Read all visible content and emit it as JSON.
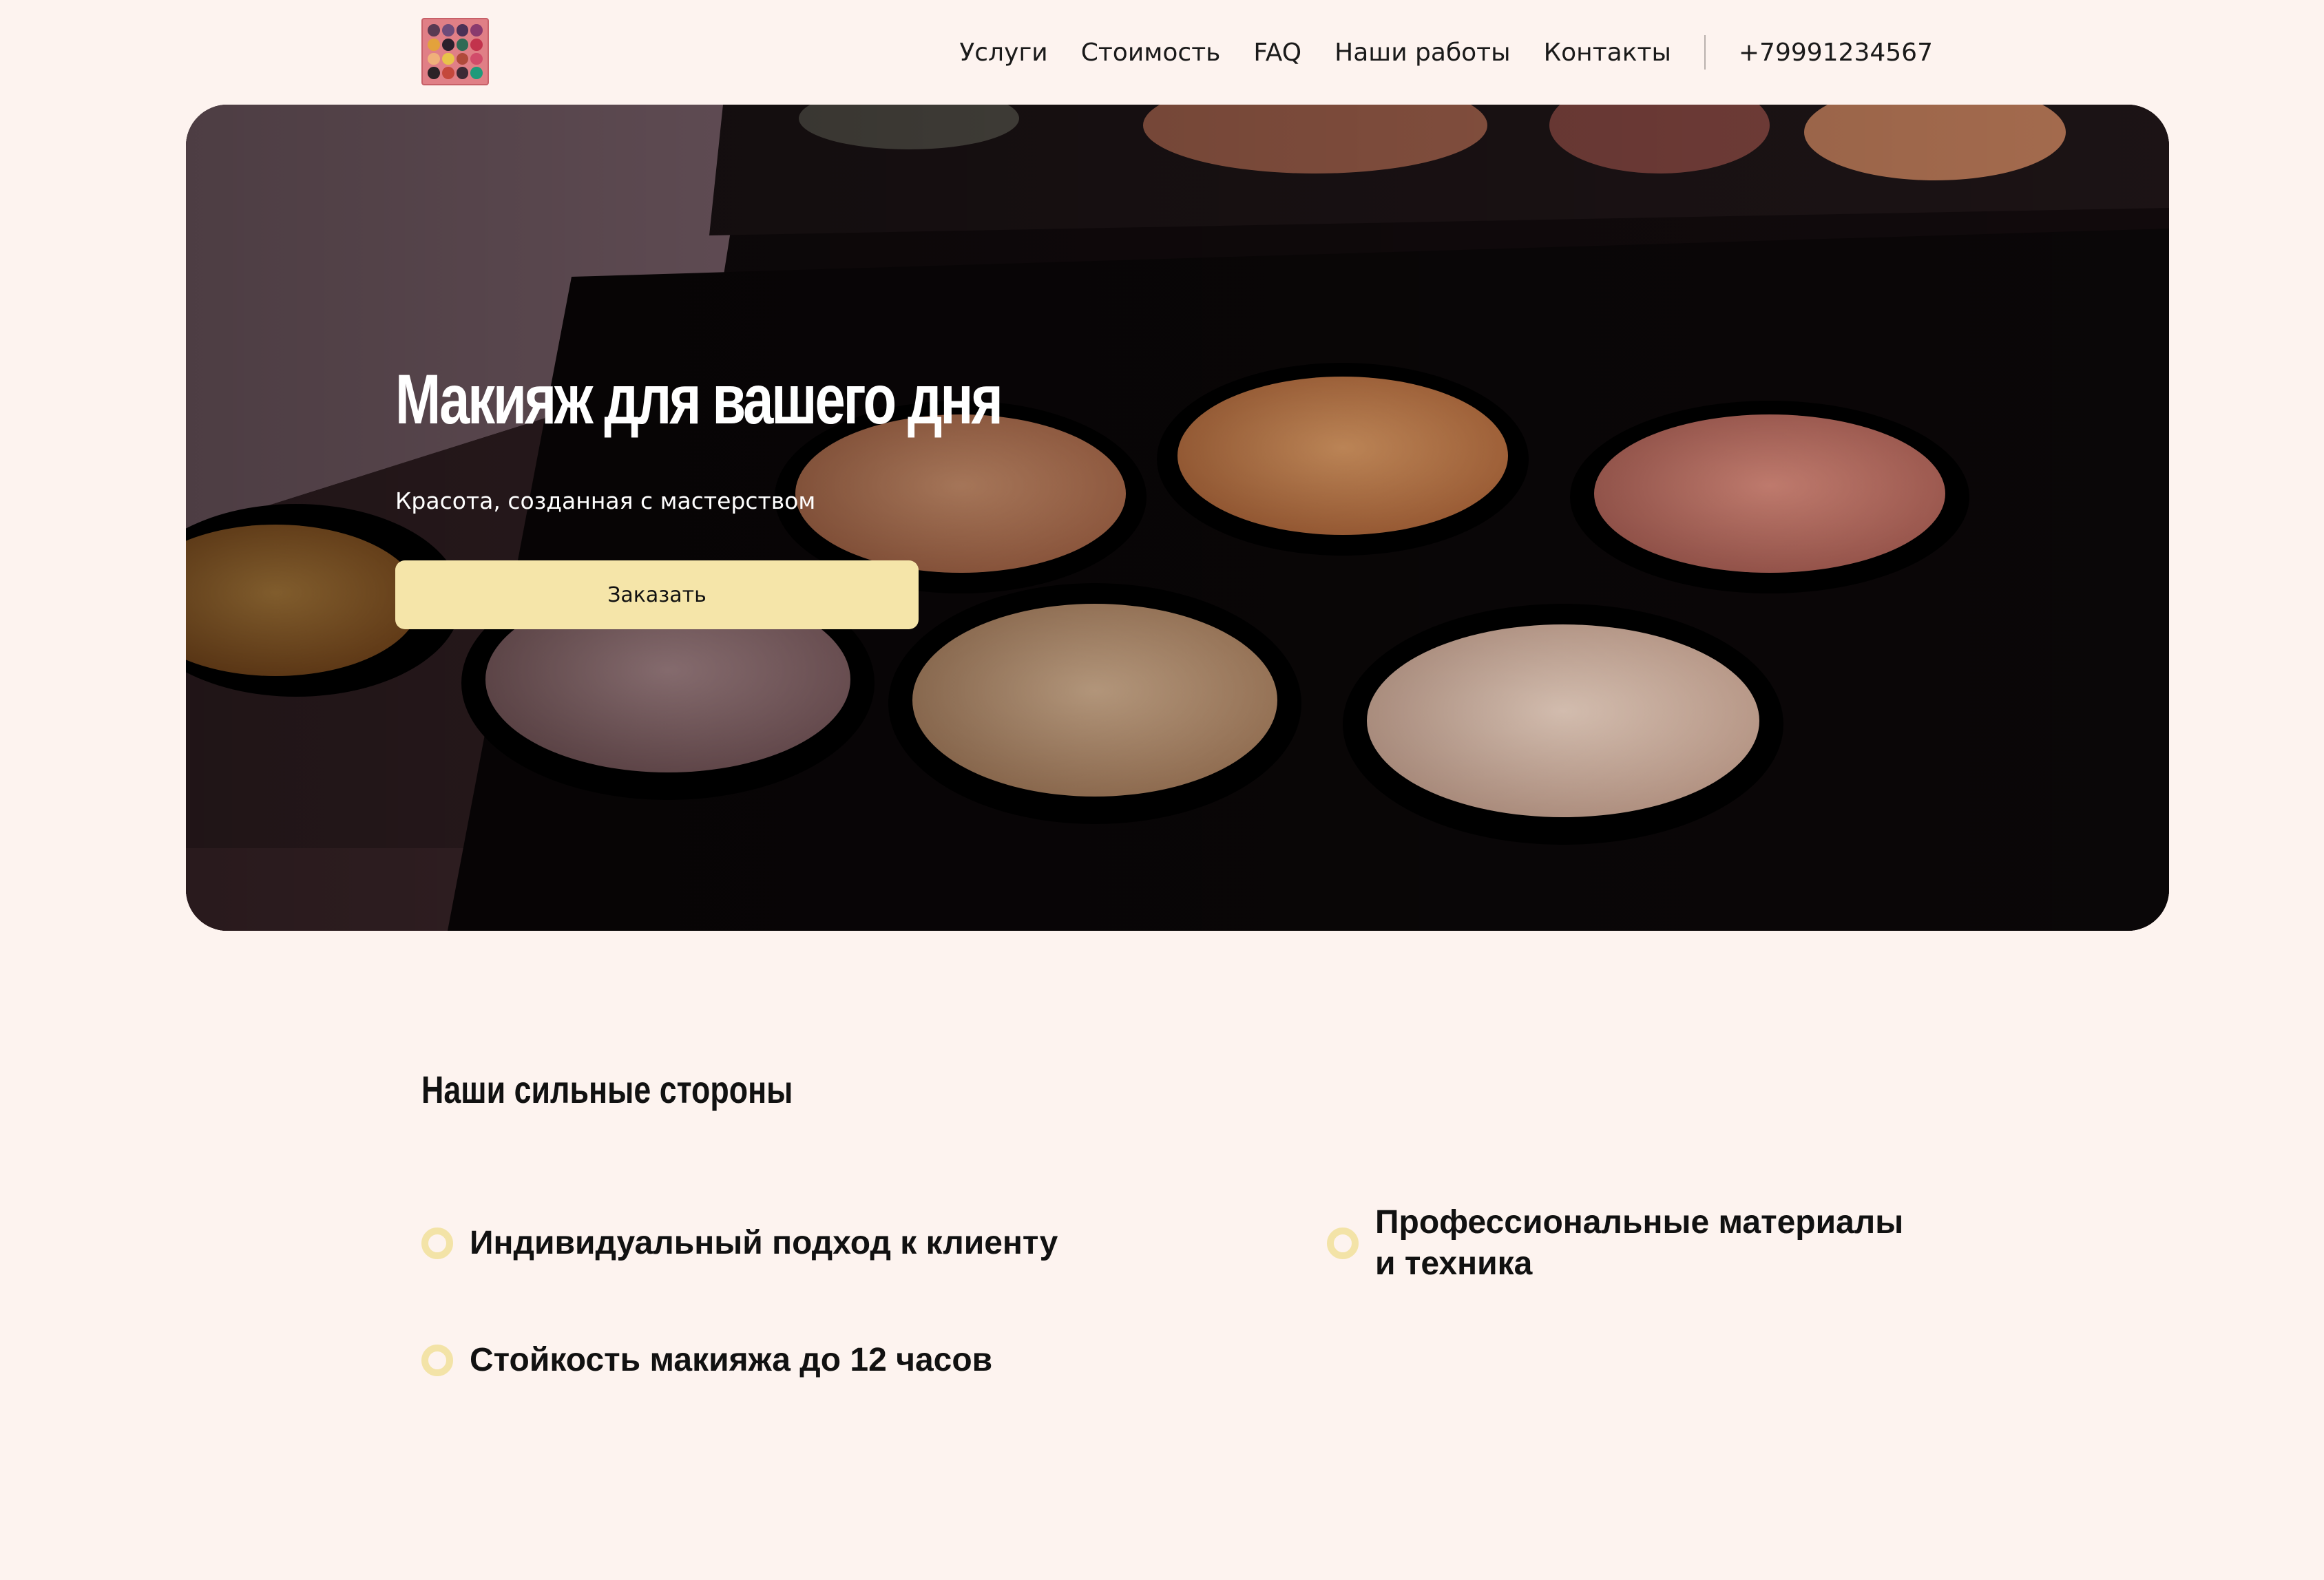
{
  "header": {
    "logo": "palette-logo",
    "nav": [
      "Услуги",
      "Стоимость",
      "FAQ",
      "Наши работы",
      "Контакты"
    ],
    "phone": "+79991234567"
  },
  "hero": {
    "title": "Макияж для вашего дня",
    "subtitle": "Красота, созданная с мастерством",
    "cta_label": "Заказать",
    "image": "makeup-palette-photo"
  },
  "strengths": {
    "title": "Наши сильные стороны",
    "items": [
      "Индивидуальный подход к клиенту",
      "Профессиональные материалы и техника",
      "Стойкость макияжа до 12 часов"
    ]
  },
  "colors": {
    "background": "#fdf3ef",
    "accent": "#f5e5a9",
    "logo": "#e07f86"
  }
}
